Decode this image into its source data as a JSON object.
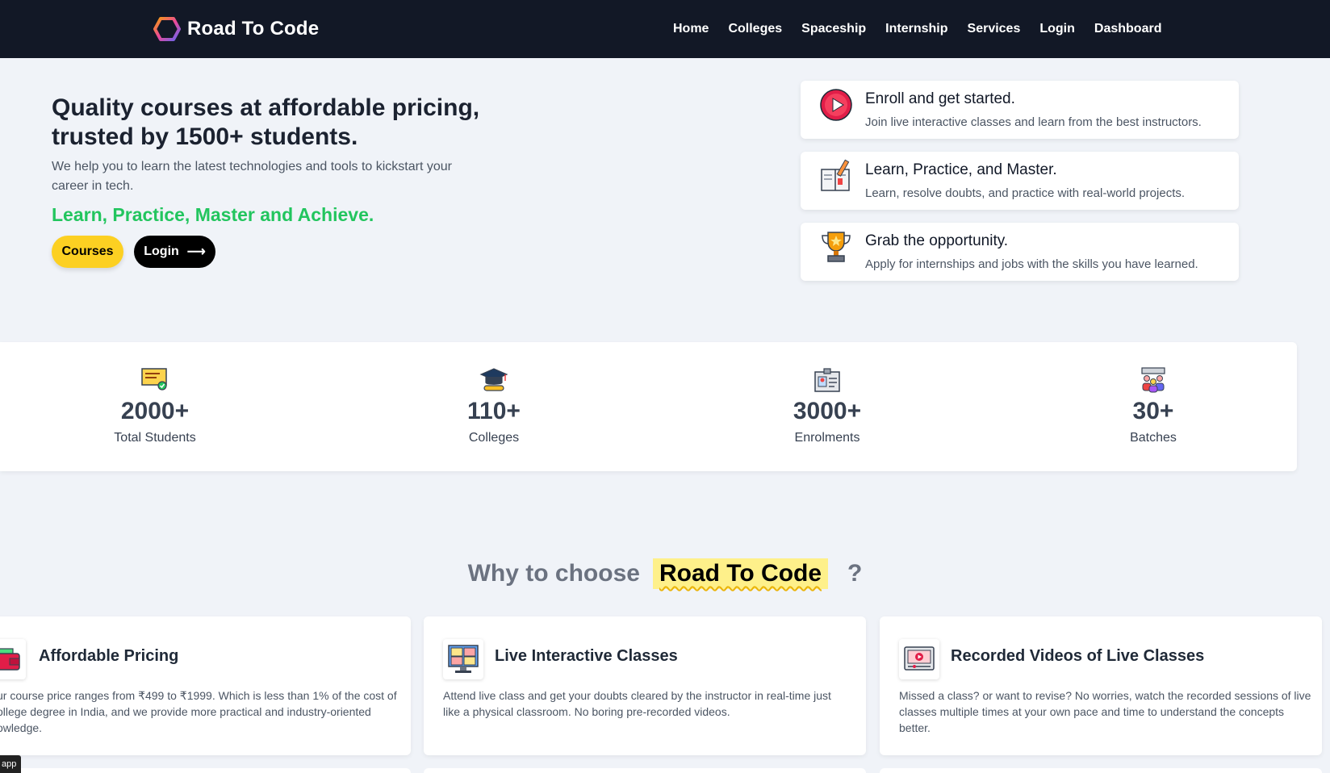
{
  "nav": {
    "brand": "Road To Code",
    "links": [
      "Home",
      "Colleges",
      "Spaceship",
      "Internship",
      "Services",
      "Login",
      "Dashboard"
    ]
  },
  "hero": {
    "title": "Quality courses at affordable pricing, trusted by 1500+ students.",
    "subtitle": "We help you to learn the latest technologies and tools to kickstart your career in tech.",
    "tagline": "Learn, Practice, Master and Achieve.",
    "courses_button": "Courses",
    "login_button": "Login",
    "login_arrow": "⟶"
  },
  "features": [
    {
      "icon": "play-icon",
      "title": "Enroll and get started.",
      "desc": "Join live interactive classes and learn from the best instructors."
    },
    {
      "icon": "book-icon",
      "title": "Learn, Practice, and Master.",
      "desc": "Learn, resolve doubts, and practice with real-world projects."
    },
    {
      "icon": "trophy-icon",
      "title": "Grab the opportunity.",
      "desc": "Apply for internships and jobs with the skills you have learned."
    }
  ],
  "stats": [
    {
      "icon": "certificate-icon",
      "value": "2000+",
      "label": "Total Students"
    },
    {
      "icon": "graduation-cap-icon",
      "value": "110+",
      "label": "Colleges"
    },
    {
      "icon": "id-card-icon",
      "value": "3000+",
      "label": "Enrolments"
    },
    {
      "icon": "group-icon",
      "value": "30+",
      "label": "Batches"
    }
  ],
  "why": {
    "prefix": "Why to choose",
    "brand": "Road To Code",
    "suffix": "?",
    "cards": [
      {
        "icon": "wallet-icon",
        "title": "Affordable Pricing",
        "desc_line1": "ur course price ranges from ₹499 to ₹1999. Which is less than 1% of the cost of",
        "desc_line2": "ollege degree in India, and we provide more practical and industry-oriented",
        "desc_line3": "owledge."
      },
      {
        "icon": "video-call-icon",
        "title": "Live Interactive Classes",
        "desc_line1": "Attend live class and get your doubts cleared by the instructor in real-time just",
        "desc_line2": "like a physical classroom. No boring pre-recorded videos.",
        "desc_line3": ""
      },
      {
        "icon": "video-player-icon",
        "title": "Recorded Videos of Live Classes",
        "desc_line1": "Missed a class? or want to revise? No worries, watch the recorded sessions of live",
        "desc_line2": "classes multiple times at your own pace and time to understand the concepts",
        "desc_line3": "better."
      }
    ]
  },
  "badge": "app",
  "colors": {
    "navbar": "#121826",
    "accent_yellow": "#fcd022",
    "accent_green": "#22c55e",
    "highlight": "#fef08a"
  }
}
